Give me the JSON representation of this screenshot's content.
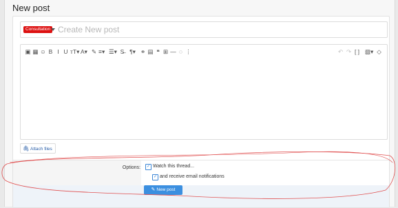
{
  "page": {
    "title": "New post"
  },
  "thread": {
    "prefix": "Consultation",
    "title_placeholder": "Create New post"
  },
  "toolbar": {
    "left": [
      {
        "name": "media-icon",
        "glyph": "▣"
      },
      {
        "name": "image-icon",
        "glyph": "▦"
      },
      {
        "name": "emoji-icon",
        "glyph": "☺"
      },
      {
        "name": "bold-icon",
        "glyph": "B"
      },
      {
        "name": "italic-icon",
        "glyph": "I"
      },
      {
        "name": "underline-icon",
        "glyph": "U"
      },
      {
        "name": "text-size-icon",
        "glyph": "тT▾"
      },
      {
        "name": "font-color-icon",
        "glyph": "A▾"
      },
      {
        "name": "palette-icon",
        "glyph": "✎"
      },
      {
        "name": "align-icon",
        "glyph": "≡▾"
      },
      {
        "name": "list-icon",
        "glyph": "☰▾"
      },
      {
        "name": "strike-icon",
        "glyph": "S̶"
      },
      {
        "name": "paragraph-icon",
        "glyph": "¶▾"
      },
      {
        "name": "link-icon",
        "glyph": "⚭"
      },
      {
        "name": "gallery-icon",
        "glyph": "▤"
      },
      {
        "name": "quote-icon",
        "glyph": "❝"
      },
      {
        "name": "table-icon",
        "glyph": "⊞"
      },
      {
        "name": "horizontal-rule-icon",
        "glyph": "—"
      },
      {
        "name": "hide-icon",
        "glyph": "◌"
      },
      {
        "name": "more-icon",
        "glyph": "⋮"
      }
    ],
    "right": [
      {
        "name": "undo-icon",
        "glyph": "↶"
      },
      {
        "name": "redo-icon",
        "glyph": "↷"
      },
      {
        "name": "bbcode-icon",
        "glyph": "[ ]"
      },
      {
        "name": "drafts-icon",
        "glyph": "▧▾"
      },
      {
        "name": "eraser-icon",
        "glyph": "◇"
      }
    ]
  },
  "attach": {
    "label": "Attach files"
  },
  "options": {
    "label": "Options:",
    "watch_label": "Watch this thread...",
    "email_label": "and receive email notifications",
    "watch_checked": true,
    "email_checked": true
  },
  "submit": {
    "label": "New post"
  },
  "colors": {
    "accent": "#3b8fe0",
    "prefix_badge": "#d11111",
    "annotation": "#e05050"
  }
}
